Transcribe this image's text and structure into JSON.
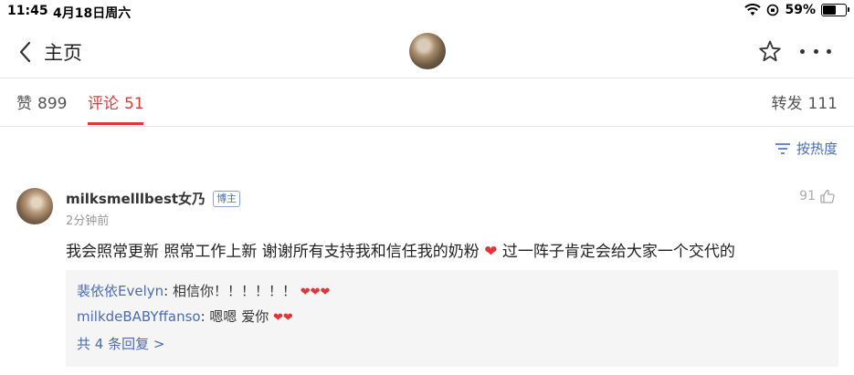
{
  "status_bar": {
    "time": "11:45",
    "date": "4月18日周六",
    "battery_percent": "59%",
    "battery_level": 0.59
  },
  "nav": {
    "back_label": "主页"
  },
  "tabs": [
    {
      "label": "赞",
      "count": "899"
    },
    {
      "label": "评论",
      "count": "51"
    },
    {
      "label": "转发",
      "count": "111"
    }
  ],
  "sort": {
    "label": "按热度"
  },
  "comment": {
    "username": "milksmelllbest女乃",
    "badge": "博主",
    "time": "2分钟前",
    "likes": "91",
    "text_before_emoji": "我会照常更新 照常工作上新 谢谢所有支持我和信任我的奶粉",
    "emoji": "❤",
    "text_after_emoji": " 过一阵子肯定会给大家一个交代的",
    "replies": [
      {
        "user": "裴依依Evelyn",
        "text": "相信你！！！！！！",
        "emoji": "❤❤❤"
      },
      {
        "user": "milkdeBABYffanso",
        "text": "嗯嗯 爱你",
        "emoji": "❤❤"
      }
    ],
    "more_replies_label": "共 4 条回复 >"
  },
  "colors": {
    "accent": "#e0363a",
    "link": "#4a6cb3"
  }
}
